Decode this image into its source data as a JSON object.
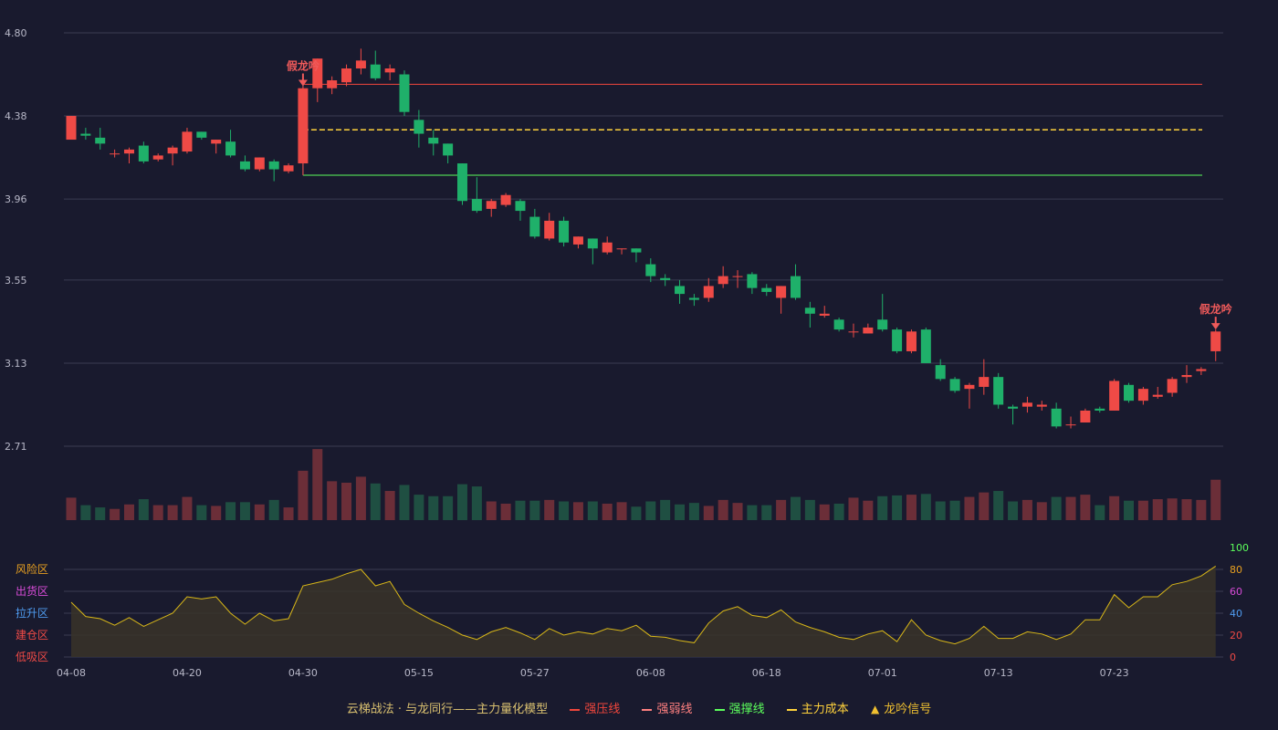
{
  "chart_data": {
    "type": "candlestick",
    "price_ticks": [
      "4.80",
      "4.38",
      "3.96",
      "3.55",
      "3.13",
      "2.71"
    ],
    "price_range": [
      2.71,
      4.8
    ],
    "osc_ticks": [
      "100",
      "80",
      "60",
      "40",
      "20",
      "0"
    ],
    "osc_range": [
      0,
      100
    ],
    "zone_labels": [
      "风险区",
      "出货区",
      "拉升区",
      "建仓区",
      "低吸区"
    ],
    "x_labels": [
      "04-08",
      "04-20",
      "04-30",
      "05-15",
      "05-27",
      "06-08",
      "06-18",
      "07-01",
      "07-13",
      "07-23"
    ],
    "x_label_index": [
      0,
      8,
      16,
      24,
      32,
      40,
      48,
      56,
      64,
      72
    ],
    "signal_label": "假龙吟",
    "signals": [
      16,
      79
    ],
    "levels": {
      "resistance": 4.54,
      "cost": 4.31,
      "support": 4.08,
      "start_index": 16
    },
    "candles": [
      [
        4.26,
        4.38,
        4.26,
        4.38
      ],
      [
        4.29,
        4.28,
        4.26,
        4.32
      ],
      [
        4.27,
        4.24,
        4.21,
        4.32
      ],
      [
        4.19,
        4.19,
        4.17,
        4.21
      ],
      [
        4.19,
        4.21,
        4.14,
        4.22
      ],
      [
        4.23,
        4.15,
        4.14,
        4.25
      ],
      [
        4.16,
        4.18,
        4.15,
        4.19
      ],
      [
        4.19,
        4.22,
        4.13,
        4.23
      ],
      [
        4.2,
        4.3,
        4.19,
        4.32
      ],
      [
        4.3,
        4.27,
        4.26,
        4.3
      ],
      [
        4.24,
        4.26,
        4.19,
        4.26
      ],
      [
        4.25,
        4.18,
        4.17,
        4.31
      ],
      [
        4.15,
        4.11,
        4.1,
        4.18
      ],
      [
        4.11,
        4.17,
        4.1,
        4.17
      ],
      [
        4.15,
        4.11,
        4.05,
        4.16
      ],
      [
        4.1,
        4.13,
        4.09,
        4.14
      ],
      [
        4.14,
        4.52,
        4.08,
        4.53
      ],
      [
        4.52,
        4.67,
        4.45,
        4.67
      ],
      [
        4.52,
        4.56,
        4.49,
        4.58
      ],
      [
        4.55,
        4.62,
        4.53,
        4.64
      ],
      [
        4.62,
        4.66,
        4.59,
        4.72
      ],
      [
        4.64,
        4.57,
        4.56,
        4.71
      ],
      [
        4.6,
        4.62,
        4.56,
        4.64
      ],
      [
        4.59,
        4.4,
        4.38,
        4.61
      ],
      [
        4.36,
        4.29,
        4.22,
        4.41
      ],
      [
        4.27,
        4.24,
        4.18,
        4.31
      ],
      [
        4.24,
        4.18,
        4.14,
        4.24
      ],
      [
        4.14,
        3.95,
        3.93,
        4.14
      ],
      [
        3.96,
        3.9,
        3.89,
        4.07
      ],
      [
        3.91,
        3.95,
        3.87,
        3.96
      ],
      [
        3.93,
        3.98,
        3.92,
        3.99
      ],
      [
        3.95,
        3.9,
        3.85,
        3.96
      ],
      [
        3.87,
        3.77,
        3.76,
        3.91
      ],
      [
        3.76,
        3.85,
        3.75,
        3.89
      ],
      [
        3.85,
        3.74,
        3.72,
        3.87
      ],
      [
        3.73,
        3.77,
        3.71,
        3.77
      ],
      [
        3.76,
        3.71,
        3.63,
        3.76
      ],
      [
        3.69,
        3.74,
        3.68,
        3.77
      ],
      [
        3.71,
        3.71,
        3.68,
        3.71
      ],
      [
        3.71,
        3.69,
        3.64,
        3.71
      ],
      [
        3.63,
        3.57,
        3.54,
        3.66
      ],
      [
        3.56,
        3.55,
        3.52,
        3.58
      ],
      [
        3.52,
        3.48,
        3.43,
        3.55
      ],
      [
        3.46,
        3.45,
        3.42,
        3.48
      ],
      [
        3.46,
        3.52,
        3.44,
        3.56
      ],
      [
        3.53,
        3.57,
        3.51,
        3.62
      ],
      [
        3.57,
        3.57,
        3.51,
        3.6
      ],
      [
        3.58,
        3.51,
        3.48,
        3.59
      ],
      [
        3.51,
        3.49,
        3.47,
        3.53
      ],
      [
        3.46,
        3.52,
        3.38,
        3.52
      ],
      [
        3.57,
        3.46,
        3.45,
        3.63
      ],
      [
        3.41,
        3.38,
        3.31,
        3.44
      ],
      [
        3.37,
        3.38,
        3.36,
        3.42
      ],
      [
        3.35,
        3.3,
        3.29,
        3.36
      ],
      [
        3.29,
        3.29,
        3.26,
        3.33
      ],
      [
        3.28,
        3.31,
        3.28,
        3.33
      ],
      [
        3.35,
        3.3,
        3.29,
        3.48
      ],
      [
        3.3,
        3.19,
        3.18,
        3.31
      ],
      [
        3.19,
        3.29,
        3.18,
        3.3
      ],
      [
        3.3,
        3.13,
        3.13,
        3.31
      ],
      [
        3.12,
        3.05,
        3.04,
        3.15
      ],
      [
        3.05,
        2.99,
        2.98,
        3.06
      ],
      [
        3.0,
        3.02,
        2.9,
        3.03
      ],
      [
        3.01,
        3.06,
        2.97,
        3.15
      ],
      [
        3.06,
        2.92,
        2.9,
        3.08
      ],
      [
        2.91,
        2.9,
        2.82,
        2.92
      ],
      [
        2.91,
        2.93,
        2.88,
        2.96
      ],
      [
        2.91,
        2.92,
        2.89,
        2.94
      ],
      [
        2.9,
        2.81,
        2.8,
        2.93
      ],
      [
        2.82,
        2.82,
        2.8,
        2.86
      ],
      [
        2.83,
        2.89,
        2.83,
        2.9
      ],
      [
        2.9,
        2.89,
        2.88,
        2.91
      ],
      [
        2.89,
        3.04,
        2.89,
        3.05
      ],
      [
        3.02,
        2.94,
        2.93,
        3.03
      ],
      [
        2.94,
        3.0,
        2.92,
        3.01
      ],
      [
        2.96,
        2.97,
        2.95,
        3.01
      ],
      [
        2.98,
        3.05,
        2.96,
        3.06
      ],
      [
        3.06,
        3.07,
        3.03,
        3.12
      ],
      [
        3.09,
        3.1,
        3.07,
        3.11
      ],
      [
        3.19,
        3.29,
        3.14,
        3.3
      ]
    ],
    "volume_scale": [
      0,
      100
    ],
    "volumes": [
      30,
      20,
      17,
      15,
      21,
      28,
      20,
      20,
      31,
      20,
      19,
      24,
      24,
      21,
      27,
      17,
      66,
      95,
      52,
      50,
      58,
      49,
      39,
      47,
      34,
      32,
      32,
      48,
      45,
      25,
      22,
      26,
      26,
      27,
      25,
      24,
      25,
      22,
      24,
      18,
      25,
      27,
      21,
      23,
      19,
      27,
      23,
      20,
      20,
      27,
      31,
      27,
      21,
      22,
      30,
      26,
      32,
      33,
      34,
      35,
      25,
      26,
      31,
      37,
      39,
      25,
      27,
      24,
      31,
      31,
      34,
      20,
      32,
      26,
      26,
      28,
      29,
      28,
      27,
      54
    ],
    "osc_name": "",
    "osc_values": [
      50,
      37,
      35,
      29,
      36,
      28,
      34,
      40,
      55,
      53,
      55,
      40,
      30,
      40,
      33,
      35,
      65,
      68,
      71,
      76,
      80,
      65,
      69,
      48,
      40,
      33,
      27,
      20,
      16,
      23,
      27,
      22,
      16,
      26,
      20,
      23,
      21,
      26,
      24,
      29,
      19,
      18,
      15,
      13,
      31,
      42,
      46,
      38,
      36,
      43,
      32,
      27,
      23,
      18,
      16,
      21,
      24,
      14,
      34,
      20,
      15,
      12,
      17,
      28,
      17,
      17,
      23,
      21,
      16,
      21,
      34,
      34,
      57,
      45,
      55,
      55,
      66,
      69,
      74,
      83
    ]
  },
  "legend": {
    "title": "云梯战法 · 与龙同行——主力量化模型",
    "items": [
      {
        "label": "强压线",
        "color": "#f0463c",
        "style": "solid"
      },
      {
        "label": "强弱线",
        "color": "#ff8080",
        "style": "dashed"
      },
      {
        "label": "强撑线",
        "color": "#5cff5c",
        "style": "solid"
      },
      {
        "label": "主力成本",
        "color": "#ffd23c",
        "style": "dashed"
      },
      {
        "label": "龙吟信号",
        "color": "#f0c030",
        "style": "triangle"
      }
    ]
  },
  "colors": {
    "up": "#ef4a46",
    "down": "#1fb06a",
    "osc_line": "#d8b718",
    "zone_colors": [
      "#e8a020",
      "#d84cd8",
      "#4f9cf0",
      "#ef4a46",
      "#ef4a46"
    ],
    "osc_tick_colors": [
      "#5cff5c",
      "#e8a020",
      "#d84cd8",
      "#4f9cf0",
      "#ef4a46",
      "#ef4a46"
    ]
  }
}
